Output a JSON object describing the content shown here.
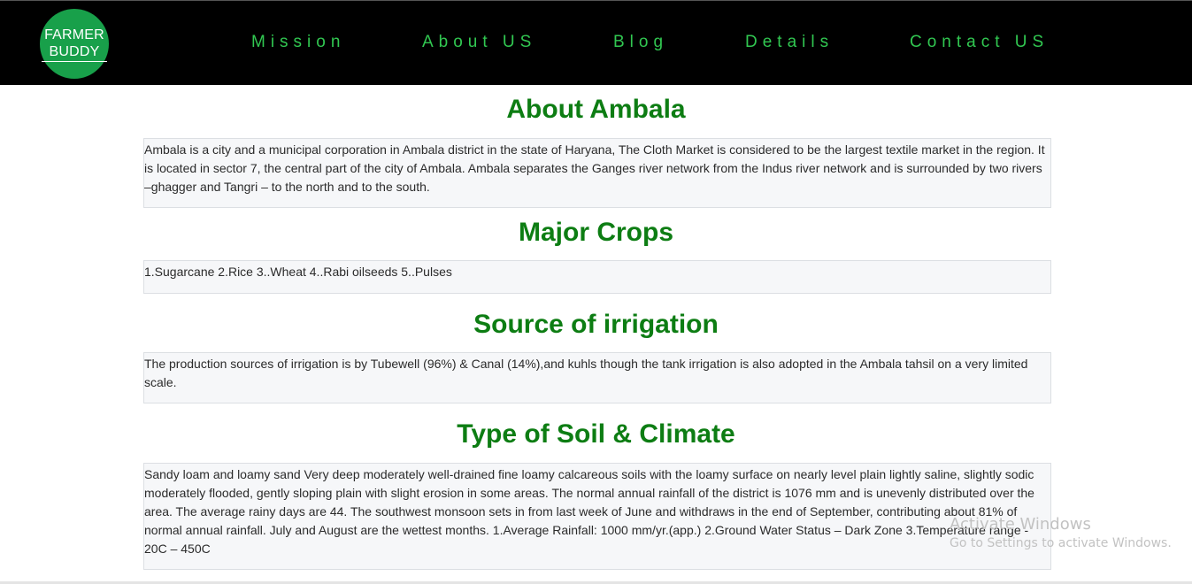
{
  "header": {
    "logo_line1": "FARMER",
    "logo_line2": "BUDDY",
    "nav": [
      "Mission",
      "About US",
      "Blog",
      "Details",
      "Contact US"
    ]
  },
  "sections": [
    {
      "title": "About Ambala",
      "text": "Ambala is a city and a municipal corporation in Ambala district in the state of Haryana,  The Cloth Market is considered to be the largest textile market in the region. It is located in sector 7, the central part of the city of Ambala. Ambala separates the Ganges river network from the Indus river network and is surrounded by two rivers –ghagger and Tangri – to the north and to the south."
    },
    {
      "title": "Major Crops",
      "text": "1.Sugarcane 2.Rice 3..Wheat 4..Rabi oilseeds 5..Pulses"
    },
    {
      "title": "Source of irrigation",
      "text": "The production sources of irrigation is by Tubewell (96%) & Canal (14%),and kuhls though the tank irrigation is also adopted in the Ambala tahsil on a very limited scale."
    },
    {
      "title": "Type of Soil & Climate",
      "text": "Sandy loam and loamy sand Very deep moderately well-drained fine loamy calcareous soils with the loamy surface on nearly level plain lightly saline, slightly sodic moderately flooded, gently sloping plain with slight erosion in some areas. The normal annual rainfall of the district is 1076 mm and is unevenly distributed over the area. The average rainy days are 44. The southwest monsoon sets in from last week of June and withdraws in the end of September, contributing about 81% of normal annual rainfall. July and August are the wettest months. 1.Average Rainfall: 1000 mm/yr.(app.) 2.Ground Water Status – Dark Zone 3.Temperature range - 20C – 450C"
    }
  ],
  "watermark": {
    "title": "Activate Windows",
    "subtitle": "Go to Settings to activate Windows."
  },
  "colors": {
    "navbar_bg": "#000000",
    "nav_text": "#31c751",
    "logo_bg": "#18a04a",
    "heading": "#0d7d13",
    "panel_bg": "#f6f7f9"
  }
}
